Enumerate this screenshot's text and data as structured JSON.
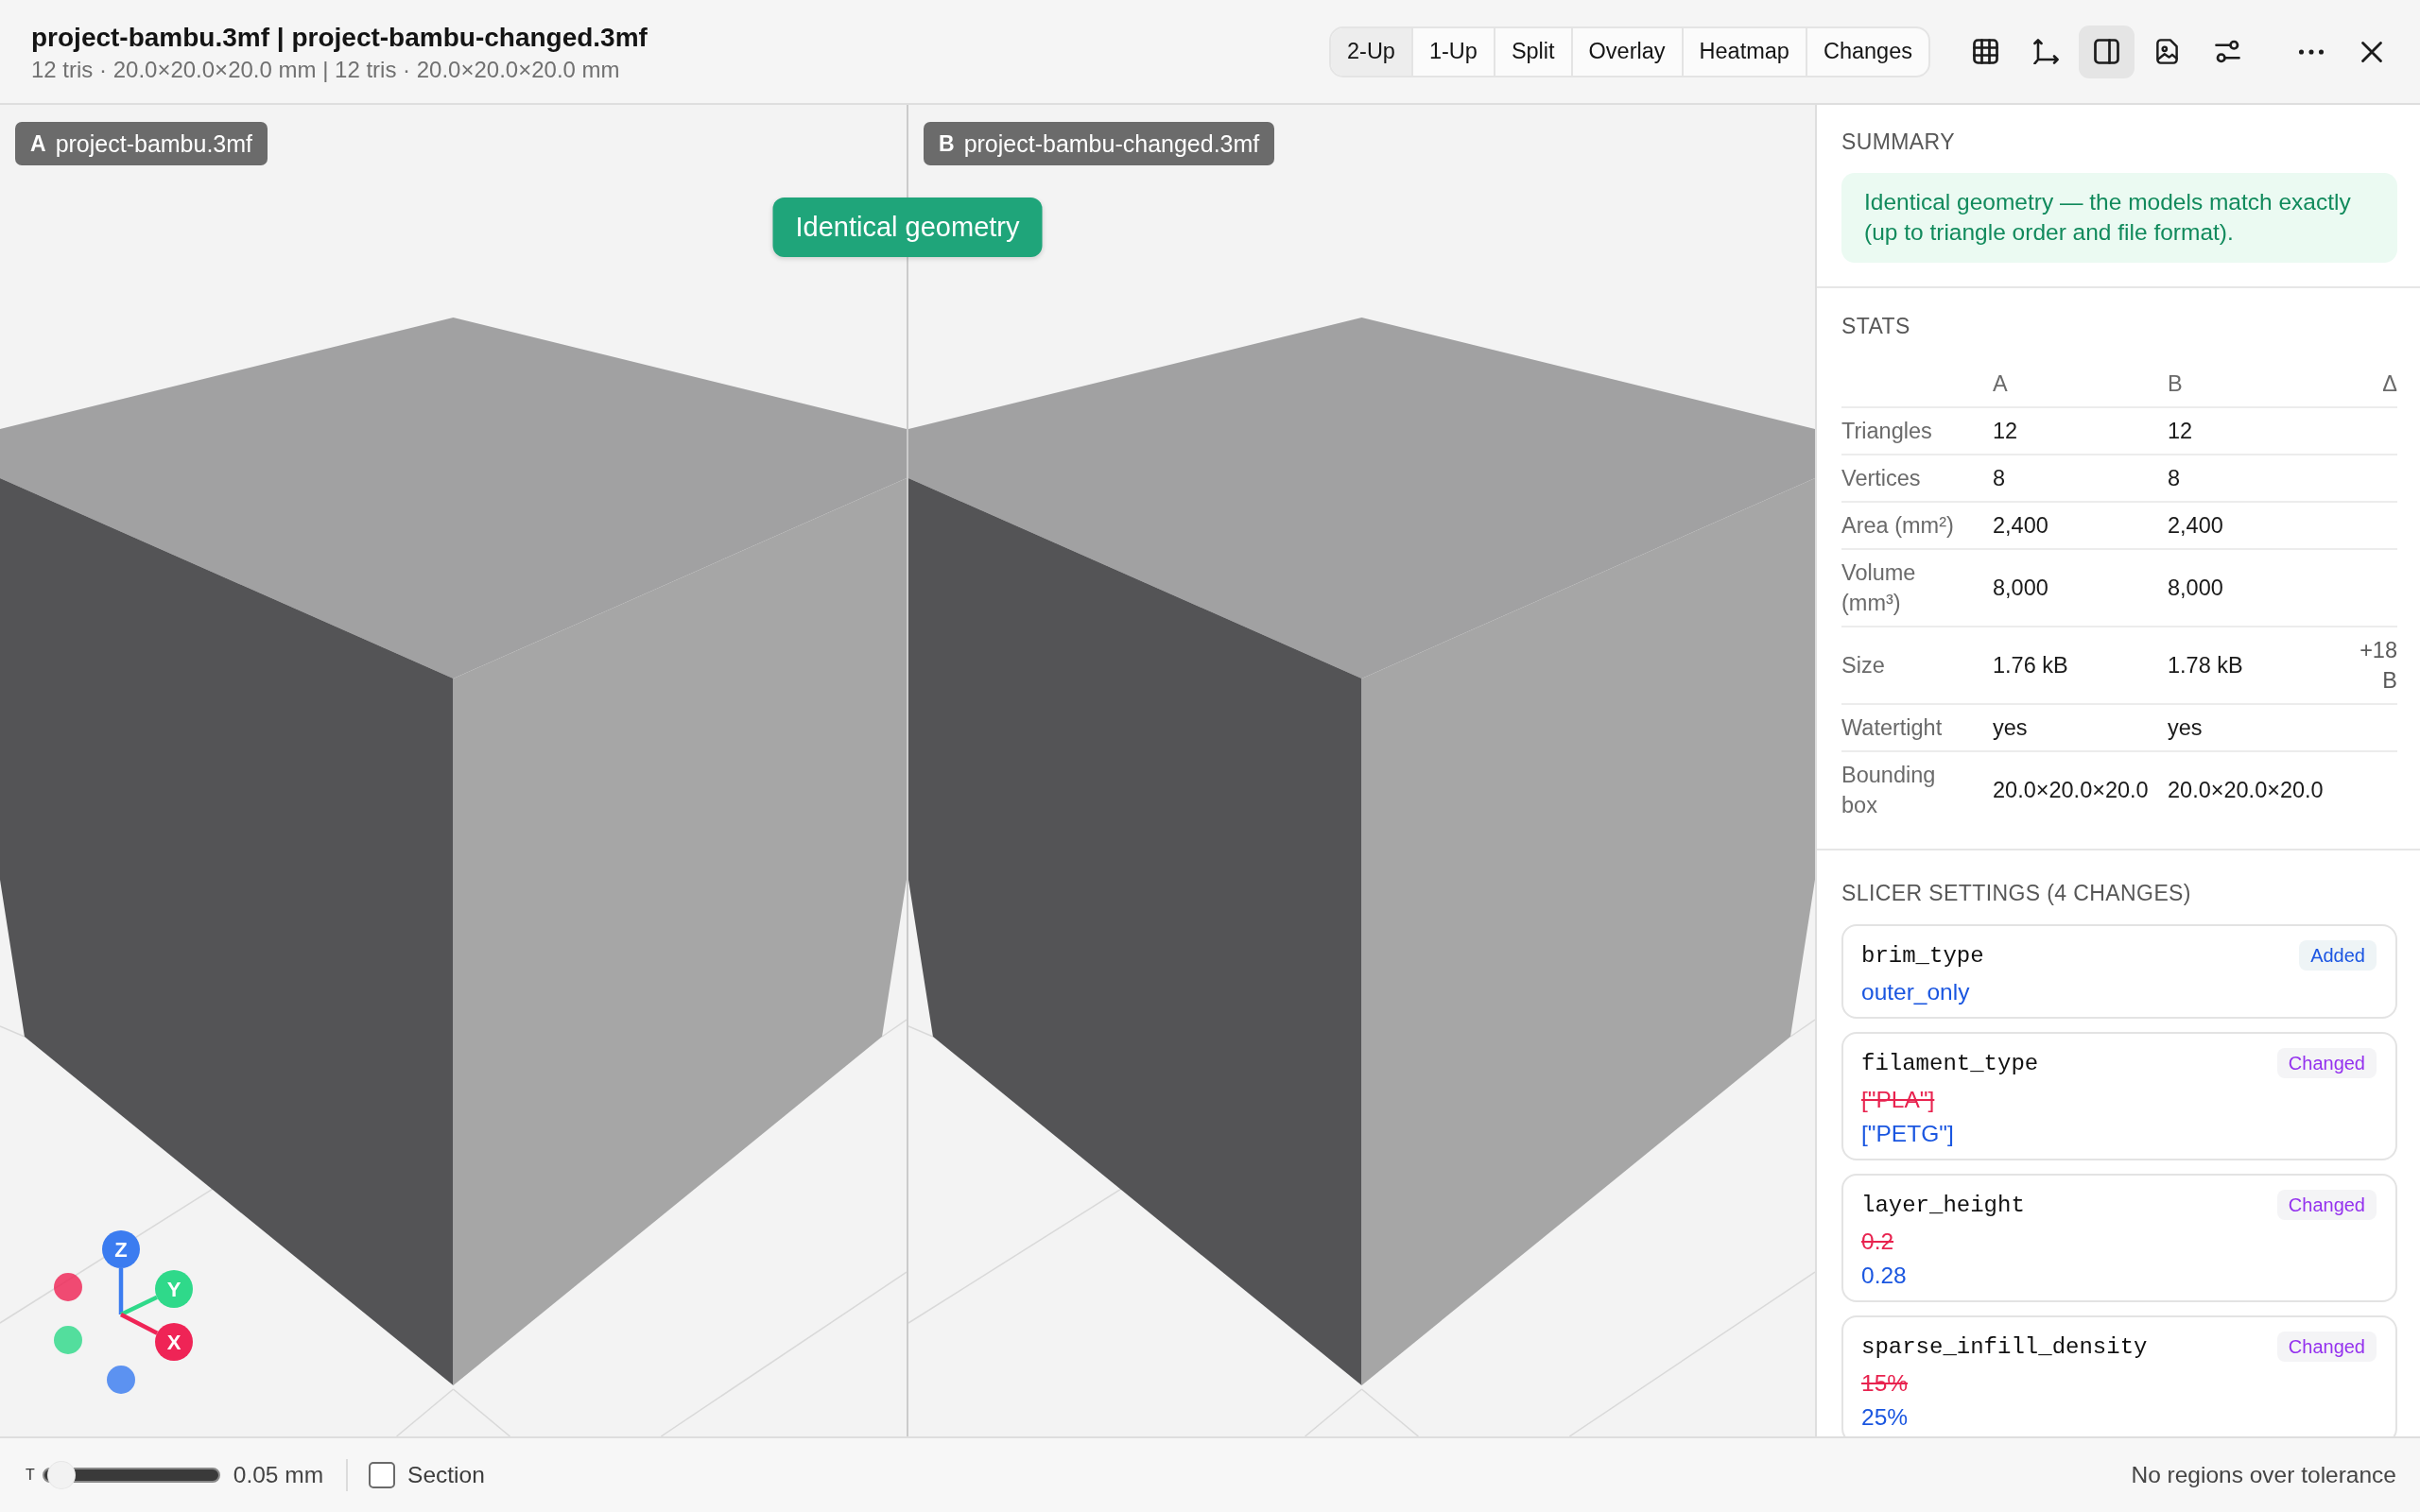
{
  "window": {
    "title": "project-bambu.3mf | project-bambu-changed.3mf",
    "subtitle": "12 tris · 20.0×20.0×20.0 mm | 12 tris · 20.0×20.0×20.0 mm"
  },
  "view_modes": [
    {
      "label": "2-Up",
      "selected": true
    },
    {
      "label": "1-Up",
      "selected": false
    },
    {
      "label": "Split",
      "selected": false
    },
    {
      "label": "Overlay",
      "selected": false
    },
    {
      "label": "Heatmap",
      "selected": false
    },
    {
      "label": "Changes",
      "selected": false
    }
  ],
  "toolbar": [
    {
      "kind": "grid",
      "selected": false
    },
    {
      "kind": "axes",
      "selected": false
    },
    {
      "kind": "panel",
      "selected": true
    },
    {
      "kind": "image",
      "selected": false
    },
    {
      "kind": "sliders",
      "selected": false
    }
  ],
  "window_controls": [
    {
      "kind": "more"
    },
    {
      "kind": "close"
    }
  ],
  "viewports": [
    {
      "letter": "A",
      "file": "project-bambu.3mf"
    },
    {
      "letter": "B",
      "file": "project-bambu-changed.3mf"
    }
  ],
  "verdict": "Identical geometry",
  "axes": [
    {
      "label": "Z",
      "color": "#3b7cf0"
    },
    {
      "label": "Y",
      "color": "#2fd98a"
    },
    {
      "label": "X",
      "color": "#ef2456"
    }
  ],
  "sidebar": {
    "summary": {
      "heading": "SUMMARY",
      "text": "Identical geometry — the models match exactly (up to triangle order and file format)."
    },
    "stats": {
      "heading": "STATS",
      "columns": [
        "A",
        "B",
        "Δ"
      ],
      "rows": [
        {
          "label": "Triangles",
          "a": "12",
          "b": "12"
        },
        {
          "label": "Vertices",
          "a": "8",
          "b": "8"
        },
        {
          "label": "Area (mm²)",
          "a": "2,400",
          "b": "2,400"
        },
        {
          "label": "Volume (mm³)",
          "a": "8,000",
          "b": "8,000"
        },
        {
          "label": "Size",
          "a": "1.76 kB",
          "b": "1.78 kB",
          "delta": "+18 B"
        },
        {
          "label": "Watertight",
          "a": "yes",
          "b": "yes"
        },
        {
          "label": "Bounding box",
          "a": "20.0×20.0×20.0",
          "b": "20.0×20.0×20.0"
        }
      ]
    },
    "slicer_settings": {
      "heading": "SLICER SETTINGS (4 CHANGES)",
      "items": [
        {
          "key": "brim_type",
          "kind": "added",
          "badge": "Added",
          "new": "outer_only"
        },
        {
          "key": "filament_type",
          "kind": "changed",
          "badge": "Changed",
          "old": "[\"PLA\"]",
          "new": "[\"PETG\"]"
        },
        {
          "key": "layer_height",
          "kind": "changed",
          "badge": "Changed",
          "old": "0.2",
          "new": "0.28"
        },
        {
          "key": "sparse_infill_density",
          "kind": "changed",
          "badge": "Changed",
          "old": "15%",
          "new": "25%"
        }
      ]
    }
  },
  "status_bar": {
    "tolerance": {
      "label": "T",
      "level": 0.03,
      "reading": "0.05 mm"
    },
    "section": {
      "label": "Section",
      "checked": false
    },
    "status": "No regions over tolerance"
  }
}
